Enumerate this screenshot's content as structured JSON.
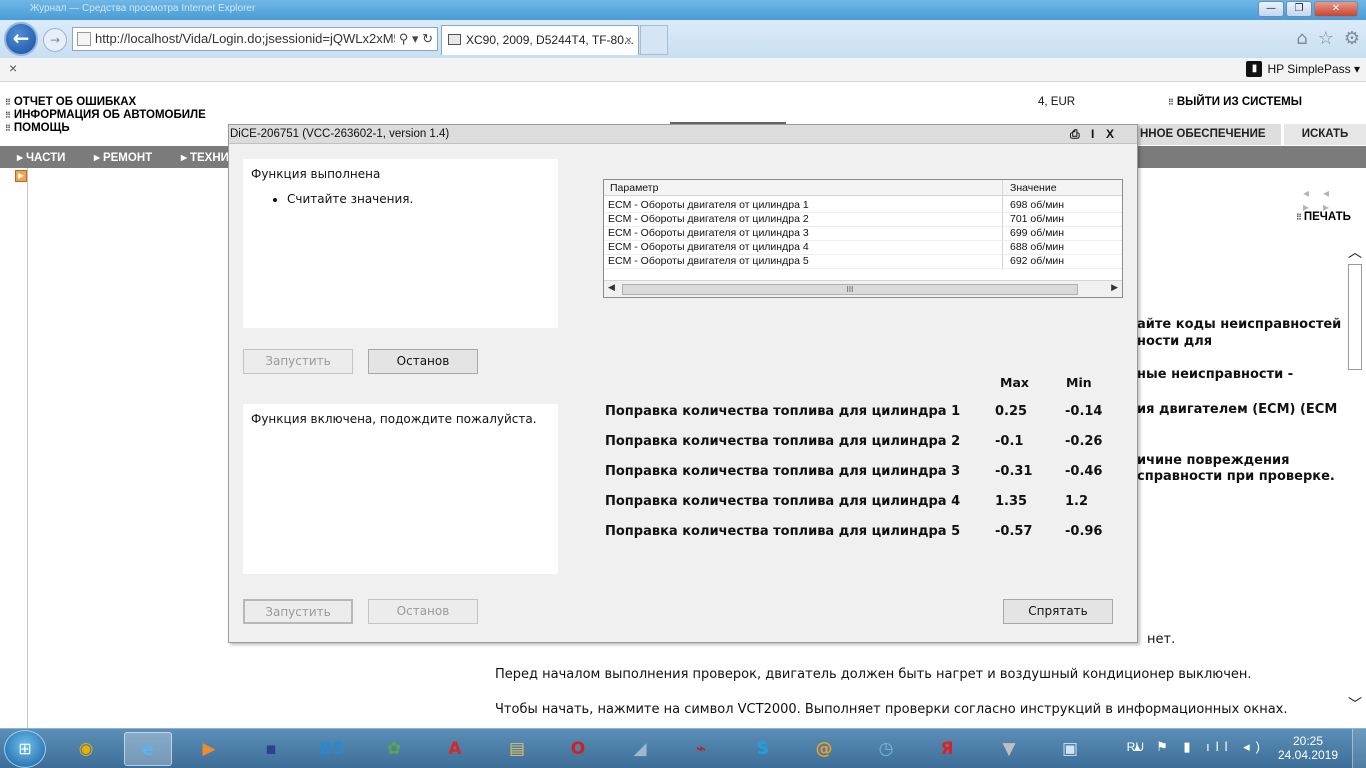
{
  "browser": {
    "title_ghost": "Журнал — Средства просмотра Internet Explorer",
    "address_url": "http://localhost/Vida/Login.do;jsessionid=jQWLx2xM5",
    "address_icons": "⚲ ▾ ↻",
    "tab_title": "XC90, 2009, D5244T4, TF-80...",
    "tab_close": "×",
    "cmd_close": "×",
    "hp_simplepass": "HP SimplePass ▾",
    "win_min": "—",
    "win_max": "❐",
    "win_close": "✕"
  },
  "vida": {
    "menu": [
      "ОТЧЕТ ОБ ОШИБКАХ",
      "ИНФОРМАЦИЯ ОБ АВТОМОБИЛЕ",
      "ПОМОЩЬ"
    ],
    "eur": "4, EUR",
    "logout": "ВЫЙТИ ИЗ СИСТЕМЫ",
    "tab_software": "ННОЕ ОБЕСПЕЧЕНИЕ",
    "tab_search": "ИСКАТЬ",
    "nav": [
      "ЧАСТИ",
      "РЕМОНТ",
      "ТЕХНИ"
    ],
    "print": "ПЕЧАТЬ",
    "pager": "◂◂ ▸▸",
    "bg_bold_lines": [
      "айте коды неисправностей",
      "ности для",
      "ные неисправности -",
      "ия двигателем (ECM) (ECM",
      "ичине повреждения",
      "справности при проверке."
    ],
    "bg_text_lines": [
      "нет.",
      "Перед началом выполнения проверок, двигатель должен быть нагрет и воздушный кондиционер выключен.",
      "Чтобы начать, нажмите на символ VCT2000. Выполняет проверки согласно инструкций в информационных окнах."
    ]
  },
  "dialog": {
    "title": "DiCE-206751   (VCC-263602-1, version 1.4)",
    "ctl_info": "I",
    "ctl_close": "X",
    "top_panel_heading": "Функция выполнена",
    "top_panel_bullet": "Считайте значения.",
    "bottom_panel_text": "Функция включена, подождите пожалуйста.",
    "btn_start": "Запустить",
    "btn_stop": "Останов",
    "btn_hide": "Спрятать",
    "table": {
      "col_param": "Параметр",
      "col_value": "Значение",
      "rows": [
        {
          "param": "ECM - Обороты двигателя от цилиндра 1",
          "value": "698 об/мин"
        },
        {
          "param": "ECM - Обороты двигателя от цилиндра 2",
          "value": "701 об/мин"
        },
        {
          "param": "ECM - Обороты двигателя от цилиндра 3",
          "value": "699 об/мин"
        },
        {
          "param": "ECM - Обороты двигателя от цилиндра 4",
          "value": "688 об/мин"
        },
        {
          "param": "ECM - Обороты двигателя от цилиндра 5",
          "value": "692 об/мин"
        }
      ],
      "scroll_grip": "III"
    },
    "max_label": "Max",
    "min_label": "Min",
    "corrections": [
      {
        "label": "Поправка количества топлива для цилиндра 1",
        "max": "0.25",
        "min": "-0.14"
      },
      {
        "label": "Поправка количества топлива для цилиндра 2",
        "max": "-0.1",
        "min": "-0.26"
      },
      {
        "label": "Поправка количества топлива для цилиндра 3",
        "max": "-0.31",
        "min": "-0.46"
      },
      {
        "label": "Поправка количества топлива для цилиндра 4",
        "max": "1.35",
        "min": "1.2"
      },
      {
        "label": "Поправка количества топлива для цилиндра 5",
        "max": "-0.57",
        "min": "-0.96"
      }
    ]
  },
  "taskbar": {
    "apps": [
      {
        "name": "chrome",
        "glyph": "◉",
        "color": "#e8b000"
      },
      {
        "name": "internet-explorer",
        "glyph": "e",
        "color": "#58b4f0"
      },
      {
        "name": "media-player",
        "glyph": "▶",
        "color": "#f08a2c"
      },
      {
        "name": "floppy-save",
        "glyph": "▪",
        "color": "#2d3f8f"
      },
      {
        "name": "bs-player",
        "glyph": "BS",
        "color": "#2a88d0"
      },
      {
        "name": "game",
        "glyph": "✿",
        "color": "#5aa84a"
      },
      {
        "name": "autocad",
        "glyph": "A",
        "color": "#d22a2a"
      },
      {
        "name": "folder",
        "glyph": "▤",
        "color": "#e8c25a"
      },
      {
        "name": "opera",
        "glyph": "O",
        "color": "#d02020"
      },
      {
        "name": "scanner",
        "glyph": "◢",
        "color": "#9fb8d0"
      },
      {
        "name": "acrobat",
        "glyph": "⌁",
        "color": "#c41a1a"
      },
      {
        "name": "skype",
        "glyph": "S",
        "color": "#1ba3e0"
      },
      {
        "name": "mail-agent",
        "glyph": "@",
        "color": "#f0a020"
      },
      {
        "name": "clock-app",
        "glyph": "◷",
        "color": "#7ab8e0"
      },
      {
        "name": "yandex",
        "glyph": "Я",
        "color": "#e02020"
      },
      {
        "name": "usb-tool",
        "glyph": "▼",
        "color": "#c0c0c0"
      },
      {
        "name": "vida-window",
        "glyph": "▣",
        "color": "#cfe4f5"
      }
    ],
    "lang": "RU",
    "tray_icons": "▴ ⚑ ▮ ıll ◂)",
    "time": "20:25",
    "date": "24.04.2019",
    "start_glyph": "⊞"
  }
}
